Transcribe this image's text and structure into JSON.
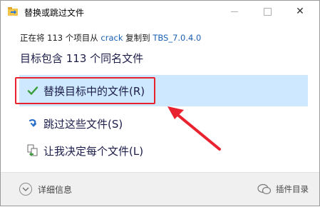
{
  "window": {
    "title": "替换或跳过文件",
    "controls": {
      "minimize": "minimize",
      "maximize": "maximize",
      "close": "✕"
    }
  },
  "subtitle": {
    "prefix": "正在将 113 个项目从",
    "source": "crack",
    "middle": "复制到",
    "destination": "TBS_7.0.4.0"
  },
  "heading": "目标包含 113 个同名文件",
  "options": [
    {
      "label": "替换目标中的文件(R)",
      "icon": "checkmark-icon"
    },
    {
      "label": "跳过这些文件(S)",
      "icon": "skip-arrow-icon"
    },
    {
      "label": "让我决定每个文件(L)",
      "icon": "compare-files-icon"
    }
  ],
  "footer": {
    "details_label": "详细信息"
  },
  "watermark": {
    "text": "插件目录"
  },
  "colors": {
    "selected_bg": "#cde8ff",
    "check_green": "#3a9d3a",
    "annotation_red": "#e8232f",
    "link_blue": "#1a5fb4"
  }
}
